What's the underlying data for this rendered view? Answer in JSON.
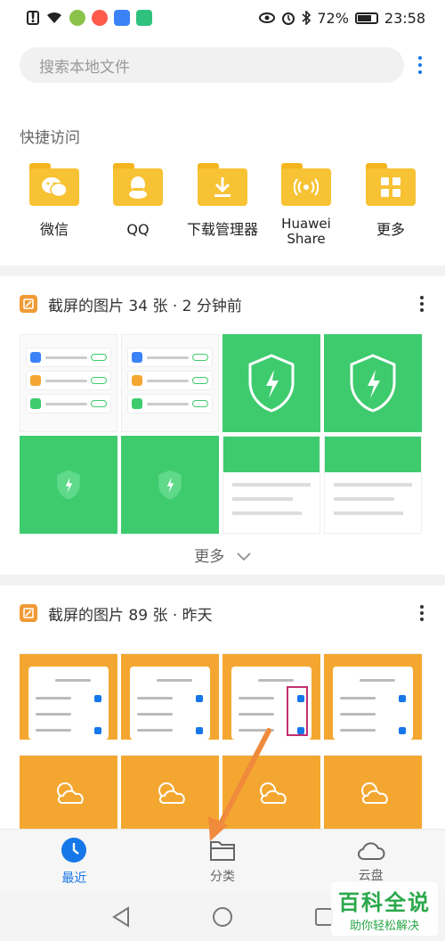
{
  "status_bar": {
    "battery_pct": "72%",
    "time": "23:58",
    "left_icons": [
      "alert-icon",
      "wifi-icon",
      "app-icon-1",
      "app-icon-2",
      "app-icon-3",
      "app-icon-4"
    ],
    "right_icons": [
      "eye-icon",
      "alarm-icon",
      "bluetooth-icon",
      "battery-icon"
    ]
  },
  "search": {
    "placeholder": "搜索本地文件"
  },
  "quick_access": {
    "title": "快捷访问",
    "items": [
      {
        "label": "微信",
        "icon": "wechat-icon"
      },
      {
        "label": "QQ",
        "icon": "qq-icon"
      },
      {
        "label": "下载管理器",
        "icon": "download-icon"
      },
      {
        "label": "Huawei\nShare",
        "icon": "share-icon"
      },
      {
        "label": "更多",
        "icon": "grid-icon"
      }
    ]
  },
  "albums": [
    {
      "title": "截屏的图片 34 张 · 2 分钟前"
    },
    {
      "title": "截屏的图片 89 张 · 昨天"
    }
  ],
  "show_more": "更多",
  "bottom_nav": {
    "items": [
      {
        "label": "最近",
        "active": true
      },
      {
        "label": "分类",
        "active": false
      },
      {
        "label": "云盘",
        "active": false
      }
    ]
  },
  "watermark": {
    "title": "百科全说",
    "subtitle": "助你轻松解决"
  },
  "colors": {
    "accent": "#1677e8",
    "folder": "#f7c233",
    "green": "#3ecb6e",
    "orange": "#f4a730",
    "arrow": "#f08a3c"
  }
}
